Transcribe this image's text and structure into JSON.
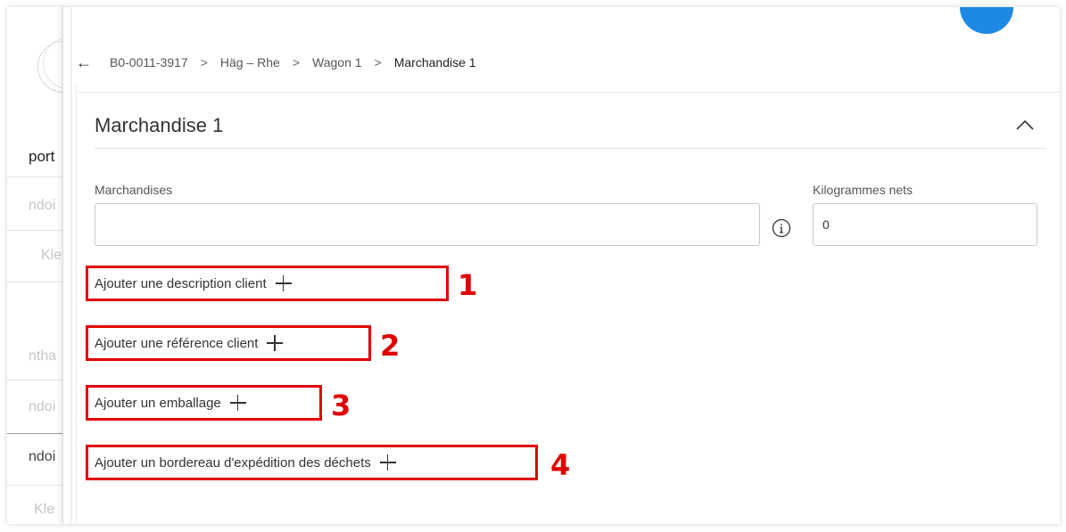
{
  "background_list": {
    "heading": "port",
    "items": [
      "ndoi",
      "Kle",
      "ntha",
      "ndoi",
      "ndoi",
      "Kle"
    ]
  },
  "breadcrumb": {
    "items": [
      "B0-0011-3917",
      "Häg – Rhe",
      "Wagon 1",
      "Marchandise 1"
    ],
    "separator": ">"
  },
  "section": {
    "title": "Marchandise 1"
  },
  "form": {
    "goods_label": "Marchandises",
    "goods_value": "",
    "net_kg_label": "Kilogrammes nets",
    "net_kg_value": "0"
  },
  "actions": [
    {
      "label": "Ajouter une description client",
      "number": "1"
    },
    {
      "label": "Ajouter une référence client",
      "number": "2"
    },
    {
      "label": "Ajouter un emballage",
      "number": "3"
    },
    {
      "label": "Ajouter un bordereau d'expédition des déchets",
      "number": "4"
    }
  ],
  "colors": {
    "annotation": "#e10000",
    "avatar": "#1e88e5"
  },
  "icons": {
    "back": "arrow-left-icon",
    "collapse": "chevron-up-icon",
    "info": "info-icon",
    "add": "plus-icon"
  }
}
